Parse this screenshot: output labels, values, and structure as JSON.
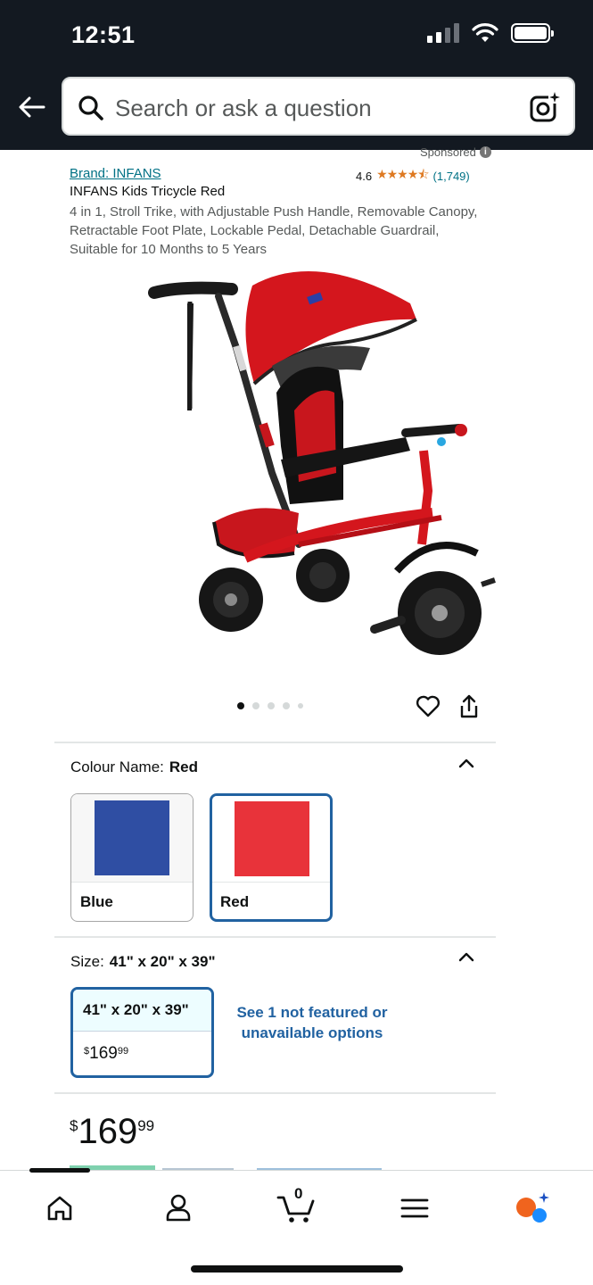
{
  "status_bar": {
    "time": "12:51"
  },
  "search": {
    "placeholder": "Search or ask a question"
  },
  "product": {
    "sponsored": "Sponsored",
    "brand": "Brand: INFANS",
    "rating": "4.6",
    "stars": "★★★★⯪",
    "rating_count": "(1,749)",
    "title": "INFANS Kids Tricycle Red",
    "subtitle": "4 in 1, Stroll Trike, with Adjustable Push Handle, Removable Canopy, Retractable Foot Plate, Lockable Pedal, Detachable Guardrail, Suitable for 10 Months to 5 Years",
    "image_count": 5,
    "active_image": 1
  },
  "colour": {
    "label": "Colour Name:",
    "selected": "Red",
    "options": [
      {
        "name": "Blue",
        "color": "#2f4ea3"
      },
      {
        "name": "Red",
        "color": "#e8333a"
      }
    ]
  },
  "size": {
    "label": "Size:",
    "selected": "41\" x 20\" x 39\"",
    "card": {
      "name": "41\" x 20\" x 39\"",
      "price_currency": "$",
      "price_whole": "169",
      "price_fraction": "99"
    },
    "see_more": "See 1 not featured or unavailable options"
  },
  "price": {
    "currency": "$",
    "whole": "169",
    "fraction": "99"
  },
  "bottom_nav": {
    "cart_count": "0"
  },
  "colors": {
    "header_bg": "#131921",
    "link": "#007185",
    "selection": "#2162a1",
    "star": "#de7921"
  }
}
